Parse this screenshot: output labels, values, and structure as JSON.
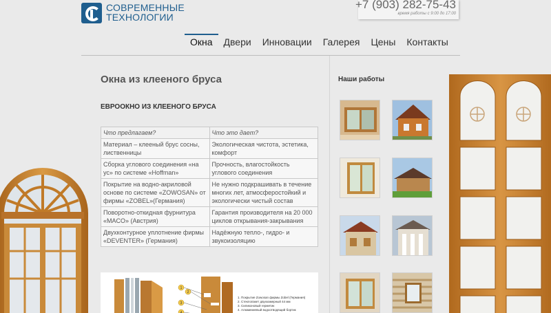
{
  "header": {
    "logo_line1": "СОВРЕМЕННЫЕ",
    "logo_line2": "ТЕХНОЛОГИИ",
    "phone": "+7 (903) 282-75-43",
    "hours": "время работы с 9:00 до 17:00"
  },
  "nav": {
    "items": [
      "Окна",
      "Двери",
      "Инновации",
      "Галерея",
      "Цены",
      "Контакты"
    ],
    "active": "Окна"
  },
  "main": {
    "title": "Окна из клееного бруса",
    "subtitle": "ЕВРООКНО ИЗ КЛЕЕНОГО БРУСА",
    "table": {
      "headers": [
        "Что предлагаем?",
        "Что это дает?"
      ],
      "rows": [
        [
          "Материал – клееный брус сосны, лиственницы",
          "Экологическая чистота, эстетика, комфорт"
        ],
        [
          "Сборка углового соединения «на ус» по системе «Hoffman»",
          "Прочность, влагостойкость углового соединения"
        ],
        [
          "Покрытие на водно-акриловой основе по системе «ZOWOSAN» от фирмы «ZOBEL»(Германия)",
          "Не нужно подкрашивать в течение многих лет, атмосферостойкий и экологически чистый состав"
        ],
        [
          "Поворотно-откидная фурнитура «MACO» (Австрия)",
          "Гарантия производителя на 20 000 циклов открывания-закрывания"
        ],
        [
          "Двухконтурное уплотнение фирмы «DEVENTER» (Германия)",
          "Надёжную тепло-, гидро- и звукоизоляцию"
        ]
      ]
    },
    "diagram": {
      "callouts": [
        "1",
        "2",
        "3",
        "4"
      ],
      "notes": [
        "1. Покрытие Zowosan фирмы Zobel (Германия)",
        "2. Стеклопакет двухкамерный 44 мм",
        "3. Силиконовый герметик",
        "4. Алюминиевый водоотводящий бортик"
      ]
    }
  },
  "sidebar": {
    "title": "Наши работы",
    "thumbnails": [
      "thumb-window-interior",
      "thumb-log-house-red",
      "thumb-window-corner",
      "thumb-house-lawn",
      "thumb-house-brick",
      "thumb-house-columns",
      "thumb-balcony-door",
      "thumb-log-wall-window"
    ]
  },
  "colors": {
    "brand": "#1f5e8e",
    "background": "#eaeaea",
    "wood": "#c8862e"
  }
}
